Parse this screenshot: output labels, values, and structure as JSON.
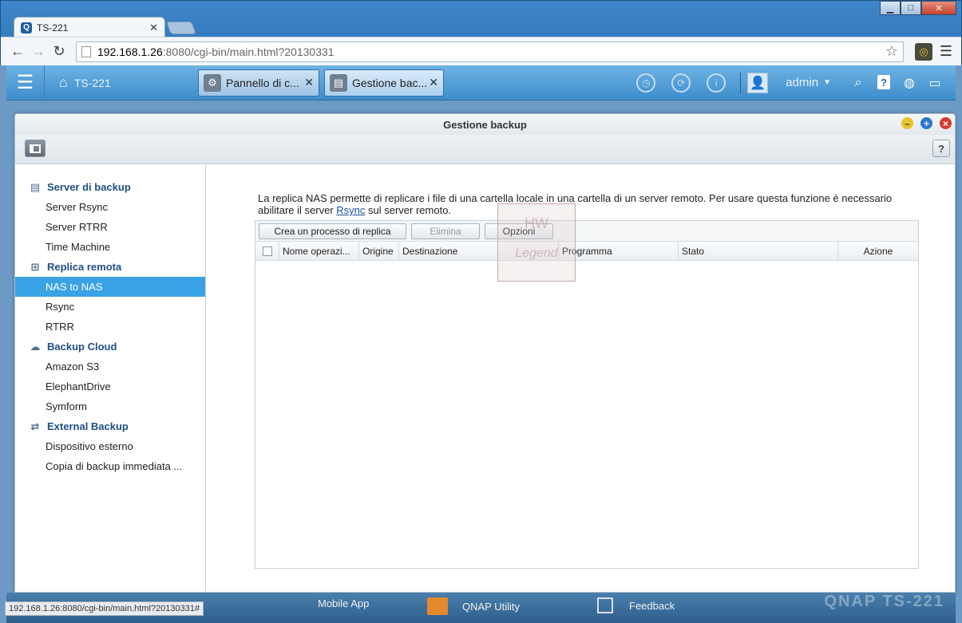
{
  "browser": {
    "tab_title": "TS-221",
    "tab_favicon": "Q",
    "url_host": "192.168.1.26",
    "url_rest": ":8080/cgi-bin/main.html?20130331",
    "status_url": "192.168.1.26:8080/cgi-bin/main.html?20130331#"
  },
  "qnap_bar": {
    "home_label": "TS-221",
    "tasks": [
      {
        "label": "Pannello di c..."
      },
      {
        "label": "Gestione bac..."
      }
    ],
    "user": "admin"
  },
  "window": {
    "title": "Gestione backup"
  },
  "sidebar": {
    "sections": [
      {
        "title": "Server di backup",
        "items": [
          "Server Rsync",
          "Server RTRR",
          "Time Machine"
        ]
      },
      {
        "title": "Replica remota",
        "items": [
          "NAS to NAS",
          "Rsync",
          "RTRR"
        ]
      },
      {
        "title": "Backup Cloud",
        "items": [
          "Amazon S3",
          "ElephantDrive",
          "Symform"
        ]
      },
      {
        "title": "External Backup",
        "items": [
          "Dispositivo esterno",
          "Copia di backup immediata ..."
        ]
      }
    ],
    "active_item": "NAS to NAS"
  },
  "main": {
    "desc_part1": "La replica NAS permette di replicare i file di una cartella locale in una cartella di un server remoto. Per usare questa funzione è necessario abilitare il server ",
    "desc_link": "Rsync",
    "desc_part2": " sul server remoto.",
    "buttons": {
      "create": "Crea un processo di replica",
      "delete": "Elimina",
      "options": "Opzioni"
    },
    "columns": [
      "Nome operazi...",
      "Origine",
      "Destinazione",
      "Programma",
      "Stato",
      "Azione"
    ]
  },
  "watermark": {
    "line1": "HW",
    "line2": "Legend"
  },
  "dock": {
    "items": [
      "Mobile App",
      "QNAP Utility",
      "Feedback"
    ],
    "brand": "QNAP TS-221"
  }
}
